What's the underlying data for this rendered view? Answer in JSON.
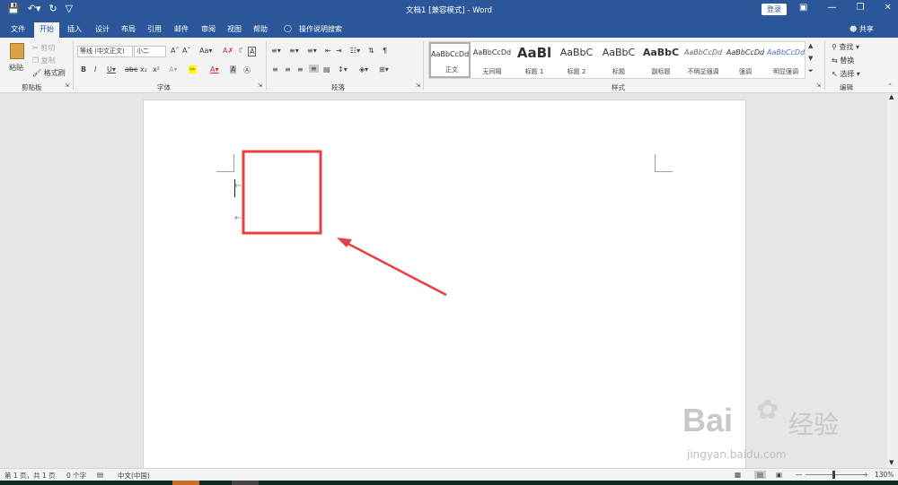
{
  "titlebar": {
    "title": "文档1 [兼容模式] - Word",
    "login": "登录"
  },
  "tabs": [
    "文件",
    "开始",
    "插入",
    "设计",
    "布局",
    "引用",
    "邮件",
    "审阅",
    "视图",
    "帮助"
  ],
  "tellme": "操作说明搜索",
  "share": "共享",
  "clipboard": {
    "paste": "粘贴",
    "cut": "剪切",
    "copy": "复制",
    "format_painter": "格式刷",
    "label": "剪贴板"
  },
  "font": {
    "name": "等线 (中文正文)",
    "size": "小二",
    "label": "字体"
  },
  "paragraph": {
    "label": "段落"
  },
  "styles": {
    "items": [
      {
        "sample": "AaBbCcDd",
        "name": "正文"
      },
      {
        "sample": "AaBbCcDd",
        "name": "无间隔"
      },
      {
        "sample": "AaBl",
        "name": "标题 1"
      },
      {
        "sample": "AaBbC",
        "name": "标题 2"
      },
      {
        "sample": "AaBbC",
        "name": "标题"
      },
      {
        "sample": "AaBbC",
        "name": "副标题"
      },
      {
        "sample": "AaBbCcDd",
        "name": "不明显强调"
      },
      {
        "sample": "AaBbCcDd",
        "name": "强调"
      },
      {
        "sample": "AaBbCcDd",
        "name": "明显强调"
      }
    ],
    "label": "样式"
  },
  "editing": {
    "find": "查找",
    "replace": "替换",
    "select": "选择",
    "label": "编辑"
  },
  "status": {
    "page": "第 1 页，共 1 页",
    "words": "0 个字",
    "lang": "中文(中国)",
    "zoom": "130%"
  },
  "watermark": {
    "brand": "Bai",
    "brand2": "经验",
    "url": "jingyan.baidu.com"
  },
  "colors": {
    "accent": "#2b579a",
    "annotation": "#e84040"
  }
}
